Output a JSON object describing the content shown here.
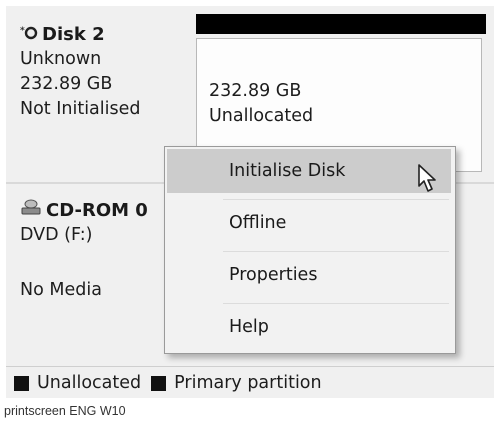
{
  "disk2": {
    "title": "Disk 2",
    "type": "Unknown",
    "size": "232.89 GB",
    "status": "Not Initialised",
    "volume": {
      "size": "232.89 GB",
      "state": "Unallocated"
    }
  },
  "cdrom": {
    "title": "CD-ROM 0",
    "drive": "DVD (F:)",
    "media": "No Media"
  },
  "context_menu": {
    "items": [
      {
        "label": "Initialise Disk"
      },
      {
        "label": "Offline"
      },
      {
        "label": "Properties"
      },
      {
        "label": "Help"
      }
    ]
  },
  "legend": {
    "unallocated": "Unallocated",
    "primary": "Primary partition"
  },
  "caption": "printscreen ENG W10",
  "colors": {
    "menu_highlight": "#cccccc",
    "volume_header": "#000000"
  }
}
